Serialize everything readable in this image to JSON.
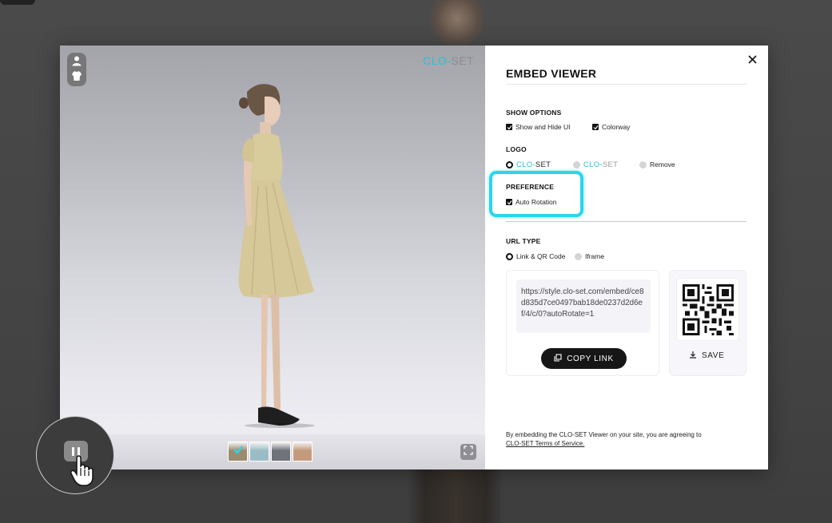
{
  "viewer": {
    "logo": {
      "clo": "CLO",
      "dash": "-",
      "set": "SET"
    },
    "colorways": [
      {
        "color": "#9c8c6e",
        "selected": true
      },
      {
        "color": "#9bbcc6",
        "selected": false
      },
      {
        "color": "#6f7278",
        "selected": false
      },
      {
        "color": "#c49a7c",
        "selected": false
      }
    ]
  },
  "panel": {
    "title": "EMBED VIEWER",
    "show_options": {
      "label": "SHOW OPTIONS",
      "items": [
        {
          "label": "Show and Hide UI",
          "checked": true
        },
        {
          "label": "Colorway",
          "checked": true
        }
      ]
    },
    "logo": {
      "label": "LOGO",
      "options": [
        {
          "clo": "CLO",
          "dash": "-",
          "set": "SET",
          "selected": true
        },
        {
          "clo": "CLO",
          "dash": "-",
          "set": "SET",
          "selected": false
        },
        {
          "label": "Remove",
          "selected": false
        }
      ]
    },
    "preference": {
      "label": "PREFERENCE",
      "items": [
        {
          "label": "Auto Rotation",
          "checked": true
        }
      ]
    },
    "url_type": {
      "label": "URL TYPE",
      "options": [
        {
          "label": "Link & QR Code",
          "selected": true
        },
        {
          "label": "Iframe",
          "selected": false
        }
      ]
    },
    "url": "https://style.clo-set.com/embed/ce8d835d7ce0497bab18de0237d2d6ef/4/c/0?autoRotate=1",
    "copy_label": "COPY LINK",
    "save_label": "SAVE",
    "disclaimer": {
      "text": "By embedding the CLO-SET Viewer on your site, you are agreeing to",
      "link": "CLO-SET Terms of Service."
    }
  },
  "colors": {
    "accent_cyan": "#28d6ee",
    "brand_cyan": "#23c4d8",
    "button_dark": "#161616"
  }
}
